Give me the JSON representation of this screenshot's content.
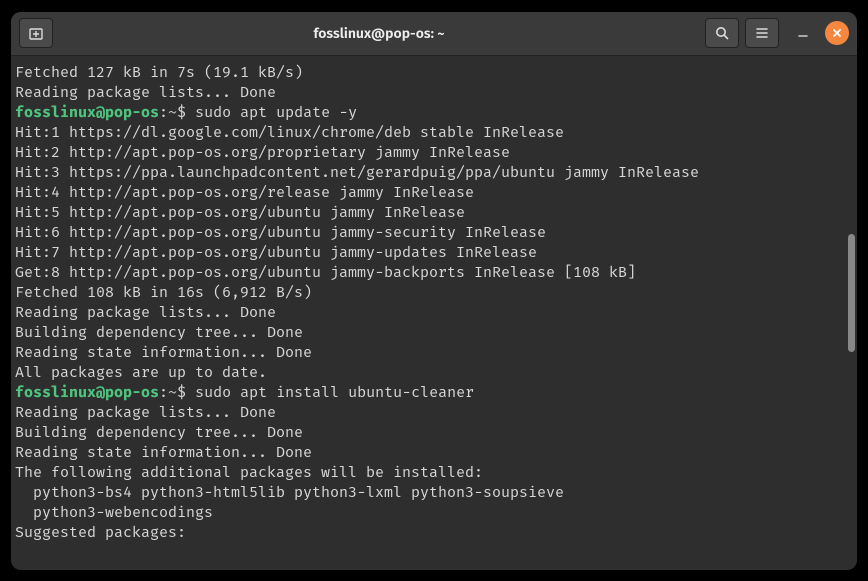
{
  "window": {
    "title": "fosslinux@pop-os: ~"
  },
  "prompt": {
    "user_host": "fosslinux@pop-os",
    "sep": ":",
    "path": "~",
    "dollar": "$"
  },
  "lines": [
    {
      "t": "plain",
      "text": "Fetched 127 kB in 7s (19.1 kB/s)"
    },
    {
      "t": "plain",
      "text": "Reading package lists... Done"
    },
    {
      "t": "prompt",
      "cmd": "sudo apt update -y"
    },
    {
      "t": "plain",
      "text": "Hit:1 https://dl.google.com/linux/chrome/deb stable InRelease"
    },
    {
      "t": "plain",
      "text": "Hit:2 http://apt.pop-os.org/proprietary jammy InRelease"
    },
    {
      "t": "plain",
      "text": "Hit:3 https://ppa.launchpadcontent.net/gerardpuig/ppa/ubuntu jammy InRelease"
    },
    {
      "t": "plain",
      "text": "Hit:4 http://apt.pop-os.org/release jammy InRelease"
    },
    {
      "t": "plain",
      "text": "Hit:5 http://apt.pop-os.org/ubuntu jammy InRelease"
    },
    {
      "t": "plain",
      "text": "Hit:6 http://apt.pop-os.org/ubuntu jammy-security InRelease"
    },
    {
      "t": "plain",
      "text": "Hit:7 http://apt.pop-os.org/ubuntu jammy-updates InRelease"
    },
    {
      "t": "plain",
      "text": "Get:8 http://apt.pop-os.org/ubuntu jammy-backports InRelease [108 kB]"
    },
    {
      "t": "plain",
      "text": "Fetched 108 kB in 16s (6,912 B/s)"
    },
    {
      "t": "plain",
      "text": "Reading package lists... Done"
    },
    {
      "t": "plain",
      "text": "Building dependency tree... Done"
    },
    {
      "t": "plain",
      "text": "Reading state information... Done"
    },
    {
      "t": "plain",
      "text": "All packages are up to date."
    },
    {
      "t": "prompt",
      "cmd": "sudo apt install ubuntu-cleaner"
    },
    {
      "t": "plain",
      "text": "Reading package lists... Done"
    },
    {
      "t": "plain",
      "text": "Building dependency tree... Done"
    },
    {
      "t": "plain",
      "text": "Reading state information... Done"
    },
    {
      "t": "plain",
      "text": "The following additional packages will be installed:"
    },
    {
      "t": "plain",
      "text": "  python3-bs4 python3-html5lib python3-lxml python3-soupsieve"
    },
    {
      "t": "plain",
      "text": "  python3-webencodings"
    },
    {
      "t": "plain",
      "text": "Suggested packages:"
    }
  ]
}
